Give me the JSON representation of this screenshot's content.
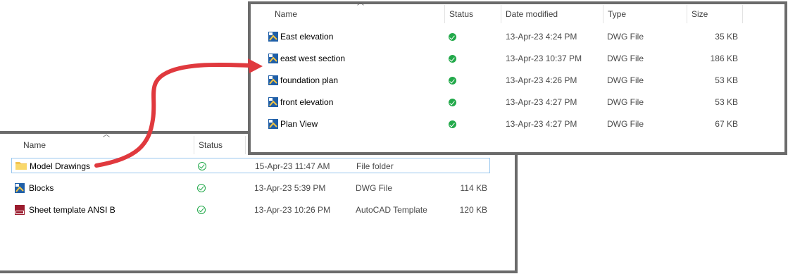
{
  "top_window": {
    "columns": {
      "name": "Name",
      "status": "Status",
      "date_modified": "Date modified",
      "type": "Type",
      "size": "Size"
    },
    "files": [
      {
        "name": "East elevation",
        "icon": "dwg-file-icon",
        "status": "synced",
        "date": "13-Apr-23 4:24 PM",
        "type": "DWG File",
        "size": "35 KB"
      },
      {
        "name": "east west section",
        "icon": "dwg-file-icon",
        "status": "synced",
        "date": "13-Apr-23 10:37 PM",
        "type": "DWG File",
        "size": "186 KB"
      },
      {
        "name": "foundation plan",
        "icon": "dwg-file-icon",
        "status": "synced",
        "date": "13-Apr-23 4:26 PM",
        "type": "DWG File",
        "size": "53 KB"
      },
      {
        "name": "front elevation",
        "icon": "dwg-file-icon",
        "status": "synced",
        "date": "13-Apr-23 4:27 PM",
        "type": "DWG File",
        "size": "53 KB"
      },
      {
        "name": "Plan View",
        "icon": "dwg-file-icon",
        "status": "synced",
        "date": "13-Apr-23 4:27 PM",
        "type": "DWG File",
        "size": "67 KB"
      }
    ]
  },
  "bottom_window": {
    "columns": {
      "name": "Name",
      "status": "Status"
    },
    "files": [
      {
        "name": "Model Drawings",
        "icon": "folder-icon",
        "status": "available",
        "date": "15-Apr-23 11:47 AM",
        "type": "File folder",
        "size": ""
      },
      {
        "name": "Blocks",
        "icon": "dwg-file-icon",
        "status": "available",
        "date": "13-Apr-23 5:39 PM",
        "type": "DWG File",
        "size": "114 KB"
      },
      {
        "name": "Sheet template ANSI B",
        "icon": "dwt-template-icon",
        "status": "available",
        "date": "13-Apr-23 10:26 PM",
        "type": "AutoCAD Template",
        "size": "120 KB"
      }
    ]
  },
  "colors": {
    "arrow": "#e0393e",
    "status_green": "#22a94a",
    "selection_border": "#99c7ee",
    "frame": "#6b6b6b"
  }
}
